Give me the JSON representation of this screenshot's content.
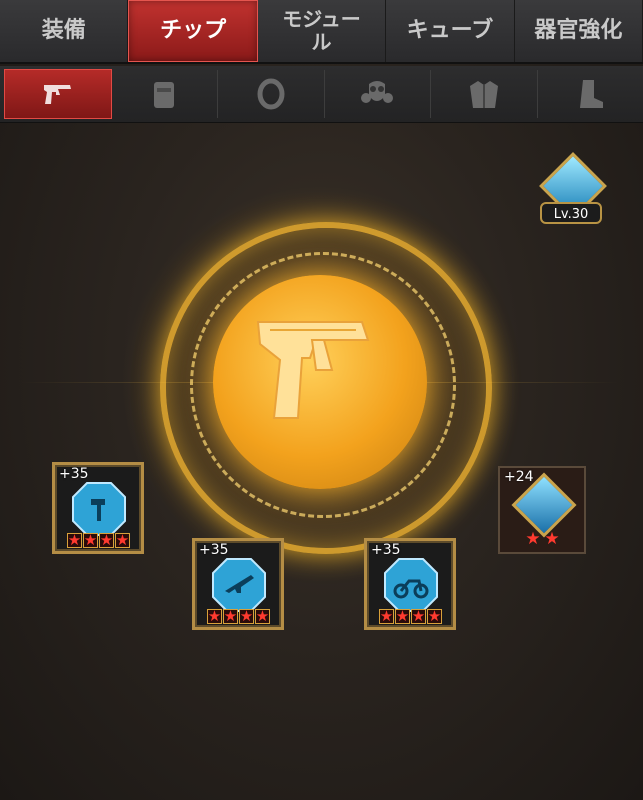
{
  "top_tabs": [
    {
      "label": "装備",
      "active": false
    },
    {
      "label": "チップ",
      "active": true
    },
    {
      "label": "モジュー\nル",
      "active": false
    },
    {
      "label": "キューブ",
      "active": false
    },
    {
      "label": "器官強化",
      "active": false
    }
  ],
  "categories": [
    {
      "icon": "pistol-icon",
      "active": true
    },
    {
      "icon": "vest-icon",
      "active": false
    },
    {
      "icon": "ring-icon",
      "active": false
    },
    {
      "icon": "gas-mask-icon",
      "active": false
    },
    {
      "icon": "jacket-icon",
      "active": false
    },
    {
      "icon": "boot-icon",
      "active": false
    }
  ],
  "center": {
    "icon": "pistol-icon",
    "accent": "#f3a21d"
  },
  "level_badge": {
    "label": "Lv.30"
  },
  "chips": [
    {
      "plus": "+35",
      "icon": "hammer-icon",
      "stars": 4
    },
    {
      "plus": "+35",
      "icon": "rifle-icon",
      "stars": 4
    },
    {
      "plus": "+35",
      "icon": "motorcycle-icon",
      "stars": 4
    },
    {
      "plus": "+24",
      "icon": "people-icon",
      "stars": 2
    }
  ],
  "star_char": "★"
}
